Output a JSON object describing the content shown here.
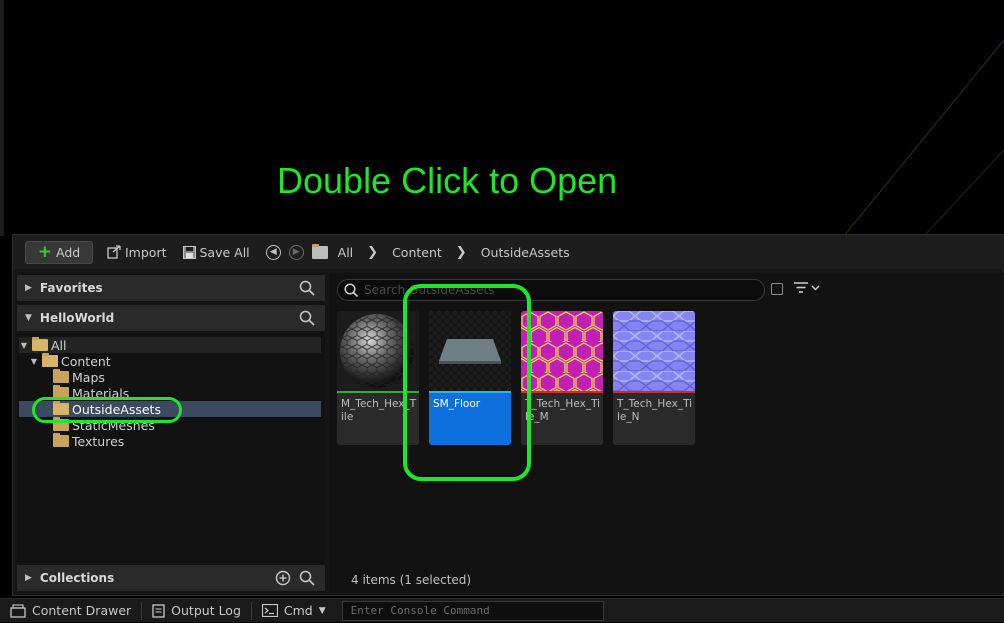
{
  "annotation": {
    "text": "Double Click to Open",
    "color": "#1ee62a"
  },
  "toolbar": {
    "add_label": "Add",
    "import_label": "Import",
    "save_all_label": "Save All",
    "breadcrumbs": [
      "All",
      "Content",
      "OutsideAssets"
    ]
  },
  "left_panel": {
    "favorites_label": "Favorites",
    "project_label": "HelloWorld",
    "collections_label": "Collections",
    "tree": [
      {
        "label": "All",
        "level": 0,
        "expanded": true
      },
      {
        "label": "Content",
        "level": 1,
        "expanded": true
      },
      {
        "label": "Maps",
        "level": 2
      },
      {
        "label": "Materials",
        "level": 2
      },
      {
        "label": "OutsideAssets",
        "level": 2,
        "selected": true
      },
      {
        "label": "StaticMeshes",
        "level": 2
      },
      {
        "label": "Textures",
        "level": 2
      }
    ]
  },
  "search": {
    "placeholder": "Search OutsideAssets"
  },
  "assets": [
    {
      "name": "M_Tech_Hex_Tile",
      "type": "material",
      "bar_color": "#3aa83a",
      "selected": false
    },
    {
      "name": "SM_Floor",
      "type": "static-mesh",
      "bar_color": "#2fb4e8",
      "selected": true
    },
    {
      "name": "T_Tech_Hex_Tile_M",
      "type": "texture",
      "bar_color": "#c83030",
      "selected": false
    },
    {
      "name": "T_Tech_Hex_Tile_N",
      "type": "texture",
      "bar_color": "#c83030",
      "selected": false
    }
  ],
  "status": {
    "items_text": "4 items (1 selected)"
  },
  "bottom_bar": {
    "content_drawer_label": "Content Drawer",
    "output_log_label": "Output Log",
    "cmd_label": "Cmd",
    "console_placeholder": "Enter Console Command"
  }
}
